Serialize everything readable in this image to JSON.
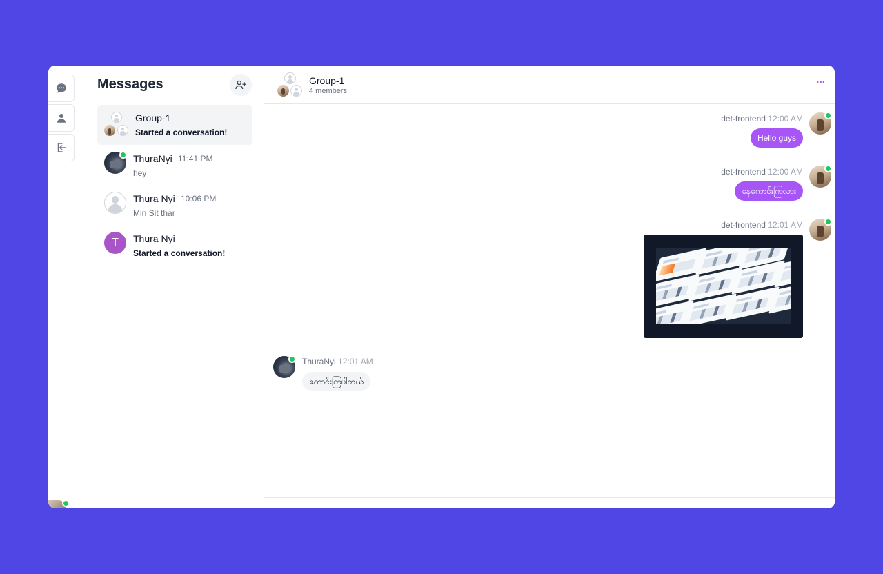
{
  "colors": {
    "background": "#4f46e5",
    "accent": "#a855f7",
    "online": "#22c55e",
    "letter_avatar": "#a855c7"
  },
  "rail": {
    "items": [
      {
        "icon": "chat-bubble-icon"
      },
      {
        "icon": "user-icon"
      },
      {
        "icon": "logout-icon"
      }
    ]
  },
  "sidebar": {
    "title": "Messages",
    "add_icon": "user-plus-icon",
    "conversations": [
      {
        "name": "Group-1",
        "time": "",
        "last": "Started a conversation!",
        "active": true
      },
      {
        "name": "ThuraNyi",
        "time": "11:41 PM",
        "last": "hey"
      },
      {
        "name": "Thura Nyi",
        "time": "10:06 PM",
        "last": "Min Sit thar"
      },
      {
        "name": "Thura Nyi",
        "time": "",
        "last": "Started a conversation!",
        "avatar_letter": "T"
      }
    ]
  },
  "chat": {
    "title": "Group-1",
    "subtitle": "4 members",
    "more_label": "···",
    "messages": [
      {
        "sender": "det-frontend",
        "time": "12:00 AM",
        "text": "Hello guys",
        "outgoing": true
      },
      {
        "sender": "det-frontend",
        "time": "12:00 AM",
        "text": "နေကောင်းကြလား",
        "outgoing": true
      },
      {
        "sender": "det-frontend",
        "time": "12:01 AM",
        "type": "image",
        "outgoing": true
      },
      {
        "sender": "ThuraNyi",
        "time": "12:01 AM",
        "text": "ကောင်းကြပါတယ်",
        "outgoing": false
      }
    ]
  }
}
